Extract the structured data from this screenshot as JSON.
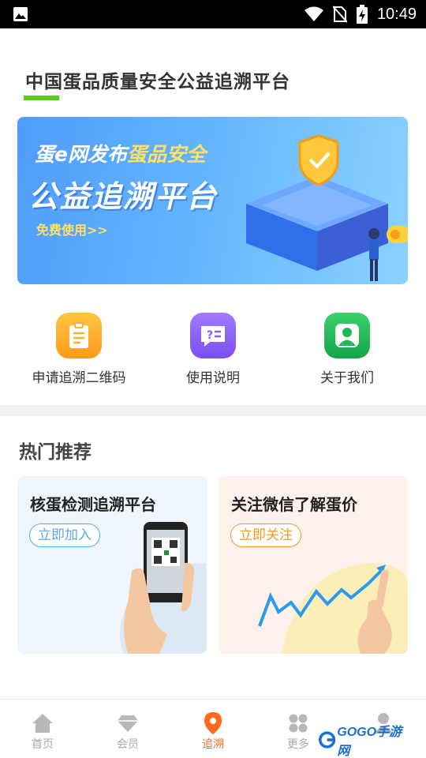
{
  "status_bar": {
    "time": "10:49"
  },
  "header": {
    "title": "中国蛋品质量安全公益追溯平台"
  },
  "banner": {
    "line1_prefix": "蛋e网发布",
    "line1_highlight": "蛋品安全",
    "line2": "公益追溯平台",
    "cta": "免费使用>>"
  },
  "shortcuts": [
    {
      "label": "申请追溯二维码",
      "icon": "clipboard-icon",
      "color": "#ffa31a"
    },
    {
      "label": "使用说明",
      "icon": "chat-help-icon",
      "color": "#8b5cf6"
    },
    {
      "label": "关于我们",
      "icon": "user-contact-icon",
      "color": "#1fb955"
    }
  ],
  "section": {
    "title": "热门推荐"
  },
  "cards": [
    {
      "title": "核蛋检测追溯平台",
      "button": "立即加入",
      "accent": "#5aa9f5",
      "bg": "#eef6fb"
    },
    {
      "title": "关注微信了解蛋价",
      "button": "立即关注",
      "accent": "#f59a23",
      "bg": "#fdf1ec"
    }
  ],
  "nav": [
    {
      "label": "首页",
      "icon": "home-icon"
    },
    {
      "label": "会员",
      "icon": "diamond-icon"
    },
    {
      "label": "追溯",
      "icon": "location-pin-icon",
      "active": true
    },
    {
      "label": "更多",
      "icon": "grid-icon"
    },
    {
      "label": "",
      "icon": "user-icon"
    }
  ],
  "watermark": {
    "text": "GOGO手游网"
  }
}
